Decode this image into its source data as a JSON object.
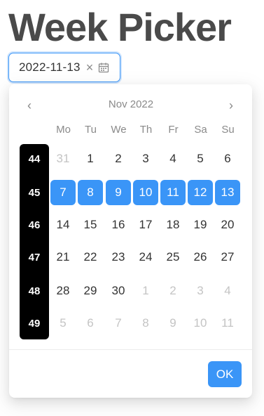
{
  "page": {
    "title": "Week Picker"
  },
  "input": {
    "value": "2022-11-13",
    "clear_glyph": "×",
    "calendar_icon": "calendar-icon",
    "clear_icon": "close-icon"
  },
  "calendar": {
    "prev_glyph": "‹",
    "next_glyph": "›",
    "month_label": "Nov 2022",
    "weekdays": [
      "Mo",
      "Tu",
      "We",
      "Th",
      "Fr",
      "Sa",
      "Su"
    ],
    "weeks": [
      {
        "number": "44",
        "days": [
          {
            "d": "31",
            "muted": true
          },
          {
            "d": "1"
          },
          {
            "d": "2"
          },
          {
            "d": "3"
          },
          {
            "d": "4"
          },
          {
            "d": "5"
          },
          {
            "d": "6"
          }
        ]
      },
      {
        "number": "45",
        "selected": true,
        "days": [
          {
            "d": "7"
          },
          {
            "d": "8"
          },
          {
            "d": "9"
          },
          {
            "d": "10"
          },
          {
            "d": "11"
          },
          {
            "d": "12"
          },
          {
            "d": "13"
          }
        ]
      },
      {
        "number": "46",
        "days": [
          {
            "d": "14"
          },
          {
            "d": "15"
          },
          {
            "d": "16"
          },
          {
            "d": "17"
          },
          {
            "d": "18"
          },
          {
            "d": "19"
          },
          {
            "d": "20"
          }
        ]
      },
      {
        "number": "47",
        "days": [
          {
            "d": "21"
          },
          {
            "d": "22"
          },
          {
            "d": "23"
          },
          {
            "d": "24"
          },
          {
            "d": "25"
          },
          {
            "d": "26"
          },
          {
            "d": "27"
          }
        ]
      },
      {
        "number": "48",
        "days": [
          {
            "d": "28"
          },
          {
            "d": "29"
          },
          {
            "d": "30"
          },
          {
            "d": "1",
            "muted": true
          },
          {
            "d": "2",
            "muted": true
          },
          {
            "d": "3",
            "muted": true
          },
          {
            "d": "4",
            "muted": true
          }
        ]
      },
      {
        "number": "49",
        "days": [
          {
            "d": "5",
            "muted": true
          },
          {
            "d": "6",
            "muted": true
          },
          {
            "d": "7",
            "muted": true
          },
          {
            "d": "8",
            "muted": true
          },
          {
            "d": "9",
            "muted": true
          },
          {
            "d": "10",
            "muted": true
          },
          {
            "d": "11",
            "muted": true
          }
        ]
      }
    ]
  },
  "footer": {
    "ok_label": "OK"
  },
  "colors": {
    "accent": "#3a95f7",
    "week_column": "#000000",
    "muted_text": "#c4c4c4"
  }
}
